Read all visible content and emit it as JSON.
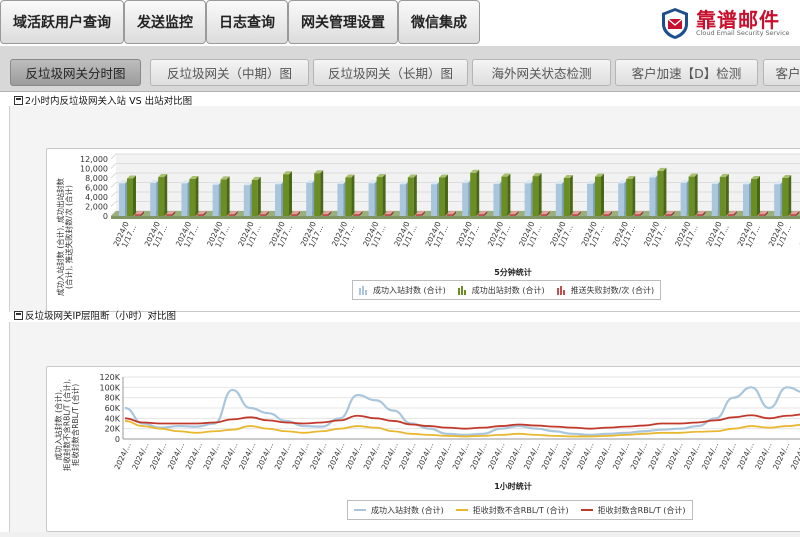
{
  "nav": {
    "items": [
      "域活跃用户查询",
      "发送监控",
      "日志查询",
      "网关管理设置",
      "微信集成"
    ]
  },
  "logo": {
    "title": "靠谱邮件",
    "subtitle": "Cloud Email Security Service",
    "icon": "envelope-shield-icon"
  },
  "tabs": [
    {
      "label": "反垃圾网关分时图",
      "active": true
    },
    {
      "label": "反垃圾网关（中期）图",
      "active": false
    },
    {
      "label": "反垃圾网关（长期）图",
      "active": false
    },
    {
      "label": "海外网关状态检测",
      "active": false
    },
    {
      "label": "客户加速【D】检测",
      "active": false
    },
    {
      "label": "客户",
      "active": false
    }
  ],
  "panel1": {
    "title": "2小时内反垃圾网关入站 VS 出站对比图",
    "legend": [
      "成功入站封数 (合计)",
      "成功出站封数 (合计)",
      "推送失败封数/次 (合计)"
    ]
  },
  "panel2": {
    "title": "反垃圾网关IP层阻断（小时）对比图",
    "legend": [
      "成功入站封数 (合计)",
      "拒收封数不含RBL/T (合计)",
      "拒收封数含RBL/T (合计)"
    ]
  },
  "colors": {
    "inbound": "#a9c6dc",
    "outbound": "#6b8e23",
    "failed": "#c0504d",
    "line_inbound": "#a9c6dc",
    "line_no_rbl": "#e8b830",
    "line_rbl": "#c0392b"
  },
  "chart_data": [
    {
      "type": "bar",
      "title": "",
      "xlabel": "5分钟统计",
      "ylabel": "成功入站封数 (合计), 成功出站封数 (合计), 推送失败封数/次 (合计)",
      "ylim": [
        0,
        12000
      ],
      "yticks": [
        "12,000",
        "10,000",
        "8,000",
        "6,000",
        "4,000",
        "2,000",
        "0"
      ],
      "categories": [
        "2024/0 1/17...",
        "2024/0 1/17...",
        "2024/0 1/17...",
        "2024/0 1/17...",
        "2024/0 1/17...",
        "2024/0 1/17...",
        "2024/0 1/17...",
        "2024/0 1/17...",
        "2024/0 1/17...",
        "2024/0 1/17...",
        "2024/0 1/17...",
        "2024/0 1/17...",
        "2024/0 1/17...",
        "2024/0 1/17...",
        "2024/0 1/17...",
        "2024/0 1/17...",
        "2024/0 1/17...",
        "2024/0 1/17...",
        "2024/0 1/17...",
        "2024/0 1/17...",
        "2024/0 1/17...",
        "2024/0 1/17...",
        "2024/0 1/17..."
      ],
      "series": [
        {
          "name": "成功入站封数 (合计)",
          "values": [
            6900,
            7000,
            6900,
            6600,
            6500,
            6700,
            7000,
            6800,
            6900,
            6700,
            6700,
            7000,
            6800,
            6900,
            6800,
            6800,
            6900,
            8100,
            7000,
            6800,
            6700,
            6700,
            6800
          ]
        },
        {
          "name": "成功出站封数 (合计)",
          "values": [
            7900,
            8200,
            7800,
            7700,
            7600,
            8800,
            9000,
            8100,
            8200,
            8100,
            8100,
            9100,
            8300,
            8400,
            8000,
            8300,
            7800,
            9500,
            8300,
            8200,
            7800,
            8000,
            8000
          ]
        },
        {
          "name": "推送失败封数/次 (合计)",
          "values": [
            400,
            400,
            400,
            400,
            400,
            400,
            400,
            400,
            400,
            400,
            400,
            400,
            400,
            400,
            400,
            400,
            400,
            400,
            400,
            400,
            400,
            400,
            400
          ]
        }
      ]
    },
    {
      "type": "line",
      "title": "",
      "xlabel": "1小时统计",
      "ylabel": "成功入站封数 (合计), 拒收封数不含RBL/T (合计), 拒收封数含RBL/T (合计)",
      "ylim": [
        0,
        120000
      ],
      "yticks": [
        "120K",
        "100K",
        "80K",
        "60K",
        "40K",
        "20K",
        "0"
      ],
      "categories": [
        "2024/...",
        "2024/...",
        "2024/...",
        "2024/...",
        "2024/...",
        "2024/...",
        "2024/...",
        "2024/...",
        "2024/...",
        "2024/...",
        "2024/...",
        "2024/...",
        "2024/...",
        "2024/...",
        "2024/...",
        "2024/...",
        "2024/...",
        "2024/...",
        "2024/...",
        "2024/...",
        "2024/...",
        "2024/...",
        "2024/...",
        "2024/...",
        "2024/...",
        "2024/...",
        "2024/...",
        "2024/...",
        "2024/...",
        "2024/...",
        "2024/...",
        "2024/...",
        "2024/...",
        "2024/...",
        "2024/...",
        "2024/...",
        "2024/...",
        "2024/...",
        "2024/..."
      ],
      "series": [
        {
          "name": "成功入站封数 (合计)",
          "values": [
            60000,
            30000,
            22000,
            25000,
            24000,
            30000,
            95000,
            60000,
            50000,
            35000,
            25000,
            24000,
            40000,
            85000,
            75000,
            55000,
            30000,
            20000,
            10000,
            8000,
            10000,
            20000,
            25000,
            20000,
            15000,
            10000,
            8000,
            10000,
            12000,
            15000,
            18000,
            20000,
            25000,
            40000,
            80000,
            100000,
            60000,
            100000,
            90000
          ]
        },
        {
          "name": "拒收封数不含RBL/T (合计)",
          "values": [
            35000,
            25000,
            20000,
            15000,
            12000,
            15000,
            18000,
            25000,
            20000,
            15000,
            12000,
            15000,
            20000,
            25000,
            22000,
            15000,
            10000,
            8000,
            6000,
            5000,
            6000,
            8000,
            10000,
            8000,
            6000,
            5000,
            5000,
            6000,
            8000,
            10000,
            12000,
            12000,
            14000,
            15000,
            20000,
            25000,
            22000,
            25000,
            28000
          ]
        },
        {
          "name": "拒收封数含RBL/T (合计)",
          "values": [
            40000,
            32000,
            30000,
            30000,
            30000,
            32000,
            38000,
            42000,
            36000,
            32000,
            30000,
            32000,
            36000,
            45000,
            40000,
            35000,
            28000,
            25000,
            22000,
            20000,
            22000,
            25000,
            28000,
            26000,
            24000,
            22000,
            20000,
            22000,
            24000,
            26000,
            30000,
            30000,
            32000,
            36000,
            42000,
            46000,
            40000,
            45000,
            48000
          ]
        }
      ]
    }
  ]
}
